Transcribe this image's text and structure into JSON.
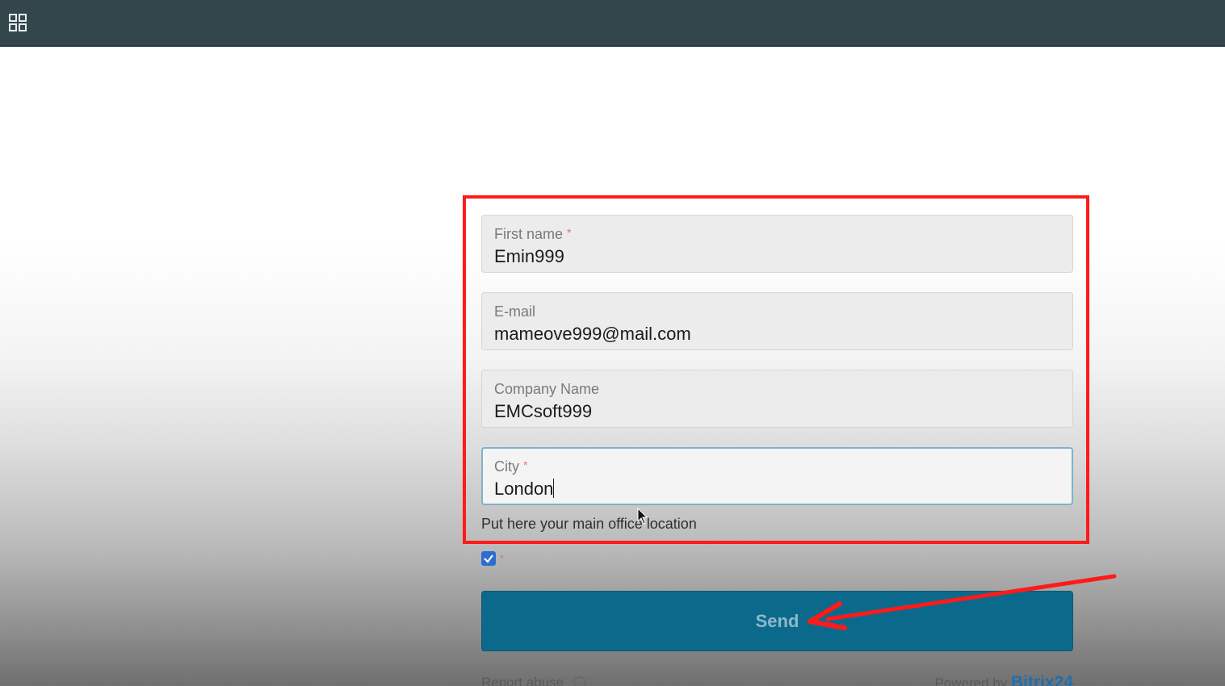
{
  "topbar": {
    "apps_icon": "grid-apps-icon"
  },
  "form": {
    "fields": [
      {
        "label": "First name",
        "required_mark": "*",
        "value": "Emin999"
      },
      {
        "label": "E-mail",
        "required_mark": "",
        "value": "mameove999@mail.com"
      },
      {
        "label": "Company Name",
        "required_mark": "",
        "value": "EMCsoft999"
      },
      {
        "label": "City",
        "required_mark": "*",
        "value": "London"
      }
    ],
    "city_hint": "Put here your main office location",
    "consent": {
      "checked": true,
      "required_mark": "*"
    },
    "send_label": "Send"
  },
  "footer": {
    "report_abuse": "Report abuse",
    "powered_by": "Powered by",
    "brand": "Bitrix24"
  },
  "annotations": {
    "highlight_color": "#ff1a1a",
    "arrow_color": "#ff1a1a"
  }
}
